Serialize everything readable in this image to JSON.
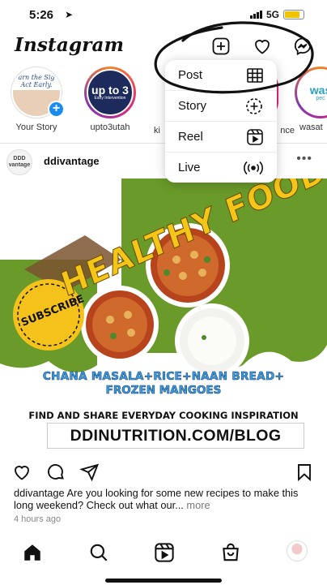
{
  "status_bar": {
    "time": "5:26",
    "network": "5G",
    "battery_fill_fraction": 0.8,
    "battery_color": "#f2c300"
  },
  "header": {
    "logo": "Instagram",
    "icons": [
      "create-plus-icon",
      "heart-icon",
      "messenger-icon"
    ]
  },
  "create_menu": {
    "items": [
      {
        "label": "Post",
        "icon": "grid-icon"
      },
      {
        "label": "Story",
        "icon": "story-plus-icon"
      },
      {
        "label": "Reel",
        "icon": "reel-icon"
      },
      {
        "label": "Live",
        "icon": "live-icon"
      }
    ]
  },
  "stories": [
    {
      "name": "Your Story",
      "thumb_text": "arn the Sig Act Early."
    },
    {
      "name": "upto3utah",
      "thumb_text": "up to 3",
      "thumb_sub": "Early Intervention"
    },
    {
      "name": "ki"
    },
    {
      "name": "nce"
    },
    {
      "name": "wasat",
      "thumb_text": "was",
      "thumb_sub": "pec"
    }
  ],
  "post": {
    "username": "ddivantage",
    "avatar_text": "DDD vantage",
    "image": {
      "title": "HEALTHY FOOD",
      "badge": "SUBSCRIBE",
      "line1": "CHANA MASALA+RICE+NAAN BREAD+",
      "line2": "FROZEN MANGOES",
      "line3": "FIND AND SHARE EVERYDAY COOKING INSPIRATION",
      "url": "DDINUTRITION.COM/BLOG"
    },
    "caption_user": "ddivantage",
    "caption_text": " Are you looking for some new recipes to make this long weekend?  Check out what our...",
    "caption_more": " more",
    "time_ago": "4 hours ago"
  },
  "bottom_nav": [
    "home-icon",
    "search-icon",
    "reels-icon",
    "shop-icon",
    "profile-avatar"
  ],
  "colors": {
    "accent_green": "#6a9a2a",
    "badge_yellow": "#f4c21b",
    "title_yellow": "#f5c518",
    "headline_blue": "#3aa0e0",
    "story_blue": "#1a8cf0"
  }
}
